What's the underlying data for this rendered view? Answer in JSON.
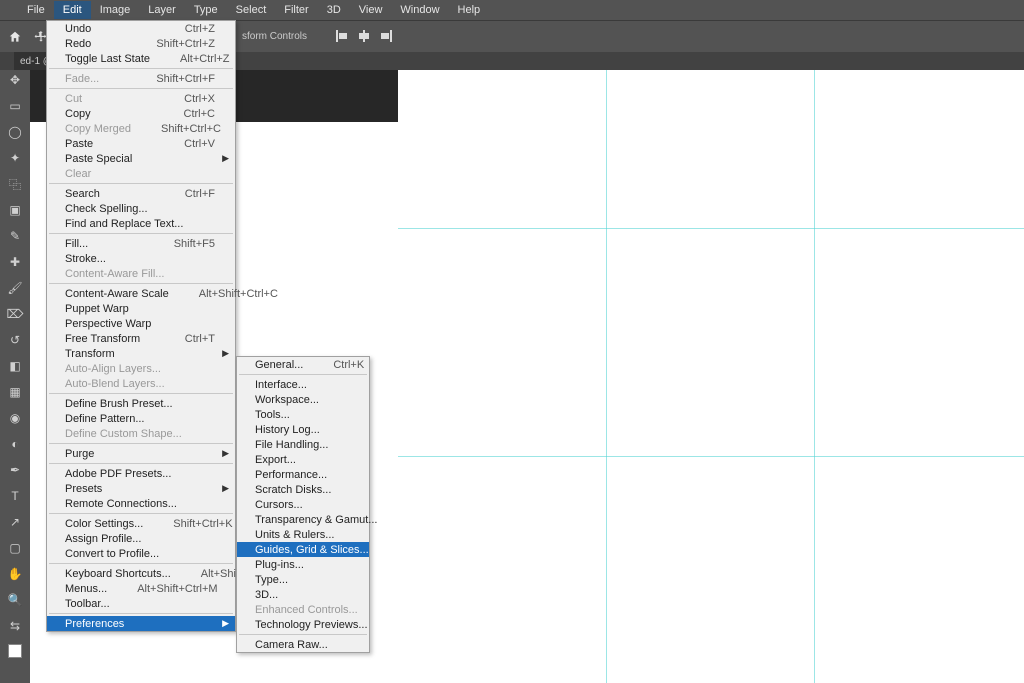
{
  "menubar": {
    "items": [
      "File",
      "Edit",
      "Image",
      "Layer",
      "Type",
      "Select",
      "Filter",
      "3D",
      "View",
      "Window",
      "Help"
    ],
    "open_index": 1
  },
  "toolbar": {
    "transform_controls": "sform Controls"
  },
  "tab": {
    "label": "ed-1 @"
  },
  "guides": {
    "h": [
      228,
      456
    ],
    "v": [
      606,
      814
    ]
  },
  "edit_menu": [
    {
      "label": "Undo",
      "shortcut": "Ctrl+Z"
    },
    {
      "label": "Redo",
      "shortcut": "Shift+Ctrl+Z"
    },
    {
      "label": "Toggle Last State",
      "shortcut": "Alt+Ctrl+Z"
    },
    {
      "sep": true
    },
    {
      "label": "Fade...",
      "shortcut": "Shift+Ctrl+F",
      "disabled": true
    },
    {
      "sep": true
    },
    {
      "label": "Cut",
      "shortcut": "Ctrl+X",
      "disabled": true
    },
    {
      "label": "Copy",
      "shortcut": "Ctrl+C"
    },
    {
      "label": "Copy Merged",
      "shortcut": "Shift+Ctrl+C",
      "disabled": true
    },
    {
      "label": "Paste",
      "shortcut": "Ctrl+V"
    },
    {
      "label": "Paste Special",
      "sub": true
    },
    {
      "label": "Clear",
      "disabled": true
    },
    {
      "sep": true
    },
    {
      "label": "Search",
      "shortcut": "Ctrl+F"
    },
    {
      "label": "Check Spelling..."
    },
    {
      "label": "Find and Replace Text..."
    },
    {
      "sep": true
    },
    {
      "label": "Fill...",
      "shortcut": "Shift+F5"
    },
    {
      "label": "Stroke..."
    },
    {
      "label": "Content-Aware Fill...",
      "disabled": true
    },
    {
      "sep": true
    },
    {
      "label": "Content-Aware Scale",
      "shortcut": "Alt+Shift+Ctrl+C"
    },
    {
      "label": "Puppet Warp"
    },
    {
      "label": "Perspective Warp"
    },
    {
      "label": "Free Transform",
      "shortcut": "Ctrl+T"
    },
    {
      "label": "Transform",
      "sub": true
    },
    {
      "label": "Auto-Align Layers...",
      "disabled": true
    },
    {
      "label": "Auto-Blend Layers...",
      "disabled": true
    },
    {
      "sep": true
    },
    {
      "label": "Define Brush Preset..."
    },
    {
      "label": "Define Pattern..."
    },
    {
      "label": "Define Custom Shape...",
      "disabled": true
    },
    {
      "sep": true
    },
    {
      "label": "Purge",
      "sub": true
    },
    {
      "sep": true
    },
    {
      "label": "Adobe PDF Presets..."
    },
    {
      "label": "Presets",
      "sub": true
    },
    {
      "label": "Remote Connections..."
    },
    {
      "sep": true
    },
    {
      "label": "Color Settings...",
      "shortcut": "Shift+Ctrl+K"
    },
    {
      "label": "Assign Profile..."
    },
    {
      "label": "Convert to Profile..."
    },
    {
      "sep": true
    },
    {
      "label": "Keyboard Shortcuts...",
      "shortcut": "Alt+Shift+Ctrl+K"
    },
    {
      "label": "Menus...",
      "shortcut": "Alt+Shift+Ctrl+M"
    },
    {
      "label": "Toolbar..."
    },
    {
      "sep": true
    },
    {
      "label": "Preferences",
      "sub": true,
      "selected": true
    }
  ],
  "prefs_menu": [
    {
      "label": "General...",
      "shortcut": "Ctrl+K"
    },
    {
      "sep": true
    },
    {
      "label": "Interface..."
    },
    {
      "label": "Workspace..."
    },
    {
      "label": "Tools..."
    },
    {
      "label": "History Log..."
    },
    {
      "label": "File Handling..."
    },
    {
      "label": "Export..."
    },
    {
      "label": "Performance..."
    },
    {
      "label": "Scratch Disks..."
    },
    {
      "label": "Cursors..."
    },
    {
      "label": "Transparency & Gamut..."
    },
    {
      "label": "Units & Rulers..."
    },
    {
      "label": "Guides, Grid & Slices...",
      "selected": true
    },
    {
      "label": "Plug-ins..."
    },
    {
      "label": "Type..."
    },
    {
      "label": "3D..."
    },
    {
      "label": "Enhanced Controls...",
      "disabled": true
    },
    {
      "label": "Technology Previews..."
    },
    {
      "sep": true
    },
    {
      "label": "Camera Raw..."
    }
  ]
}
